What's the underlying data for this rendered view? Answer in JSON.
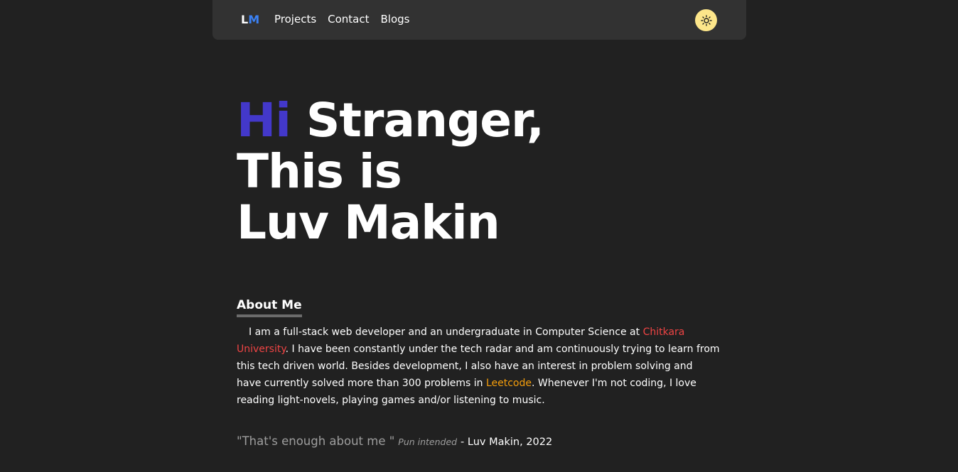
{
  "nav": {
    "logo_first": "L",
    "logo_second": "M",
    "links": [
      "Projects",
      "Contact",
      "Blogs"
    ],
    "theme_icon": "sun-icon"
  },
  "hero": {
    "hi": "Hi",
    "line1_rest": "Stranger,",
    "line2": "This is",
    "line3": "Luv Makin"
  },
  "about": {
    "heading": "About Me",
    "text_1": "I am a full-stack web developer and an undergraduate in Computer Science at",
    "university": "Chitkara University",
    "text_2": ". I have been constantly under the tech radar and am continuously trying to learn from this tech driven world. Besides development, I also have an interest in problem solving and have currently solved more than 300 problems in",
    "leetcode": "Leetcode",
    "text_3": ". Whenever I'm not coding, I love reading light-novels, playing games and/or listening to music."
  },
  "quote": {
    "text": "\"That's enough about me \"",
    "note": "Pun intended",
    "author": "- Luv Makin, 2022"
  },
  "colors": {
    "background": "#212121",
    "navbar": "#323232",
    "hi_accent": "#4338ca",
    "logo_accent": "#3b82f6",
    "university_link": "#ef4444",
    "leetcode_link": "#f59e0b",
    "theme_button": "#fde68a"
  }
}
